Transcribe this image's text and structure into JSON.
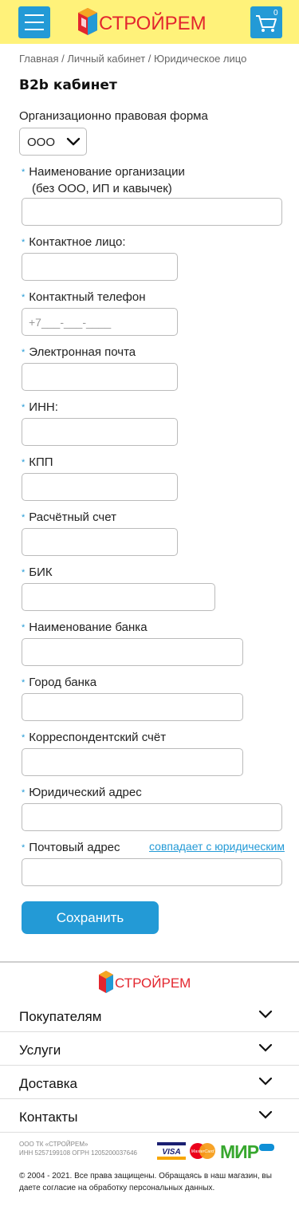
{
  "header": {
    "logo_text": "СТРОЙРЕМ",
    "cart_count": "0",
    "colors": {
      "background": "#fff27a",
      "button": "#239ad6",
      "logo_red": "#e3262e"
    },
    "icons": [
      "menu-icon",
      "cart-icon"
    ]
  },
  "breadcrumb": {
    "items": [
      "Главная",
      "Личный кабинет",
      "Юридическое лицо"
    ],
    "separator": "/"
  },
  "page_title": "B2b кабинет",
  "org_form": {
    "label": "Организационно правовая форма",
    "value": "ООО"
  },
  "fields": [
    {
      "label_line1": "Наименование организации",
      "label_line2": "(без ООО, ИП и кавычек)",
      "value": "",
      "placeholder": ""
    },
    {
      "label": "Контактное лицо:",
      "value": "",
      "placeholder": ""
    },
    {
      "label": "Контактный телефон",
      "value": "",
      "placeholder": "+7___-___-____"
    },
    {
      "label": "Электронная почта",
      "value": "",
      "placeholder": ""
    },
    {
      "label": "ИНН:",
      "value": "",
      "placeholder": ""
    },
    {
      "label": "КПП",
      "value": "",
      "placeholder": ""
    },
    {
      "label": "Расчётный счет",
      "value": "",
      "placeholder": ""
    },
    {
      "label": "БИК",
      "value": "",
      "placeholder": ""
    },
    {
      "label": "Наименование банка",
      "value": "",
      "placeholder": ""
    },
    {
      "label": "Город банка",
      "value": "",
      "placeholder": ""
    },
    {
      "label": "Корреспондентский счёт",
      "value": "",
      "placeholder": ""
    },
    {
      "label": "Юридический адрес",
      "value": "",
      "placeholder": ""
    },
    {
      "label": "Почтовый адрес",
      "value": "",
      "placeholder": ""
    }
  ],
  "required_marker": "*",
  "same_as_legal_link": "совпадает с юридическим",
  "save_button": "Сохранить",
  "footer": {
    "logo_text": "СТРОЙРЕМ",
    "accordion": [
      "Покупателям",
      "Услуги",
      "Доставка",
      "Контакты"
    ],
    "company_line1": "ООО ТК «СТРОЙРЕМ»",
    "company_line2": "ИНН 5257199108 ОГРН 1205200037646",
    "payments": [
      "VISA",
      "MasterCard",
      "МИР"
    ],
    "copyright": "© 2004 - 2021. Все права защищены.  Обращаясь в наш магазин, вы даете  согласие на обработку персональных данных."
  },
  "accent_color": "#239ad6"
}
